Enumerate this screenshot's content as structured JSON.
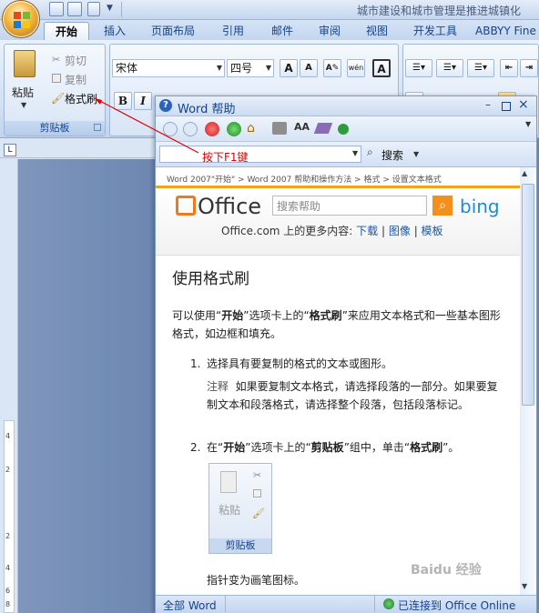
{
  "window": {
    "title": "城市建设和城市管理是推进城镇化",
    "tabs": [
      "开始",
      "插入",
      "页面布局",
      "引用",
      "邮件",
      "审阅",
      "视图",
      "开发工具",
      "ABBYY Fine"
    ]
  },
  "ribbon": {
    "paste_label": "粘贴",
    "cut_label": "剪切",
    "copy_label": "复制",
    "format_painter_label": "格式刷",
    "clipboard_group": "剪贴板",
    "font_name": "宋体",
    "font_size": "四号",
    "bold": "B",
    "italic": "I",
    "grow_font": "A",
    "shrink_font": "A",
    "char_border": "A",
    "phonetic": "wén"
  },
  "help": {
    "title": "Word 帮助",
    "search_value": "按下F1键",
    "search_button": "搜索",
    "breadcrumb": "Word 2007\"开始\" > Word 2007 帮助和操作方法 > 格式 > 设置文本格式",
    "office_logo": "Office",
    "search_placeholder": "搜索帮助",
    "bing": "bing",
    "more_prefix": "Office.com 上的更多内容:",
    "links": [
      "下载",
      "图像",
      "模板"
    ],
    "article_title": "使用格式刷",
    "intro_prefix": "可以使用“",
    "intro_b1": "开始",
    "intro_mid": "”选项卡上的“",
    "intro_b2": "格式刷",
    "intro_suffix": "”来应用文本格式和一些基本图形格式，如边框和填充。",
    "step1_num": "1.",
    "step1": "选择具有要复制的格式的文本或图形。",
    "note_label": "注释",
    "note": "如果要复制文本格式，请选择段落的一部分。如果要复制文本和段落格式，请选择整个段落，包括段落标记。",
    "step2_num": "2.",
    "step2_a": "在“",
    "step2_b1": "开始",
    "step2_c": "”选项卡上的“",
    "step2_b2": "剪贴板",
    "step2_d": "”组中，单击“",
    "step2_b3": "格式刷",
    "step2_e": "”。",
    "img_paste": "粘贴",
    "img_group": "剪贴板",
    "pointer_text": "指针变为画笔图标。",
    "status_left": "全部 Word",
    "status_right": "已连接到 Office Online"
  },
  "watermark": "Baidu 经验",
  "ruler_numbers": [
    "4",
    "2",
    "2",
    "4",
    "6",
    "8"
  ],
  "colors": {
    "accent": "#f6a219",
    "link": "#1b55a7",
    "annotation": "#e00000"
  }
}
